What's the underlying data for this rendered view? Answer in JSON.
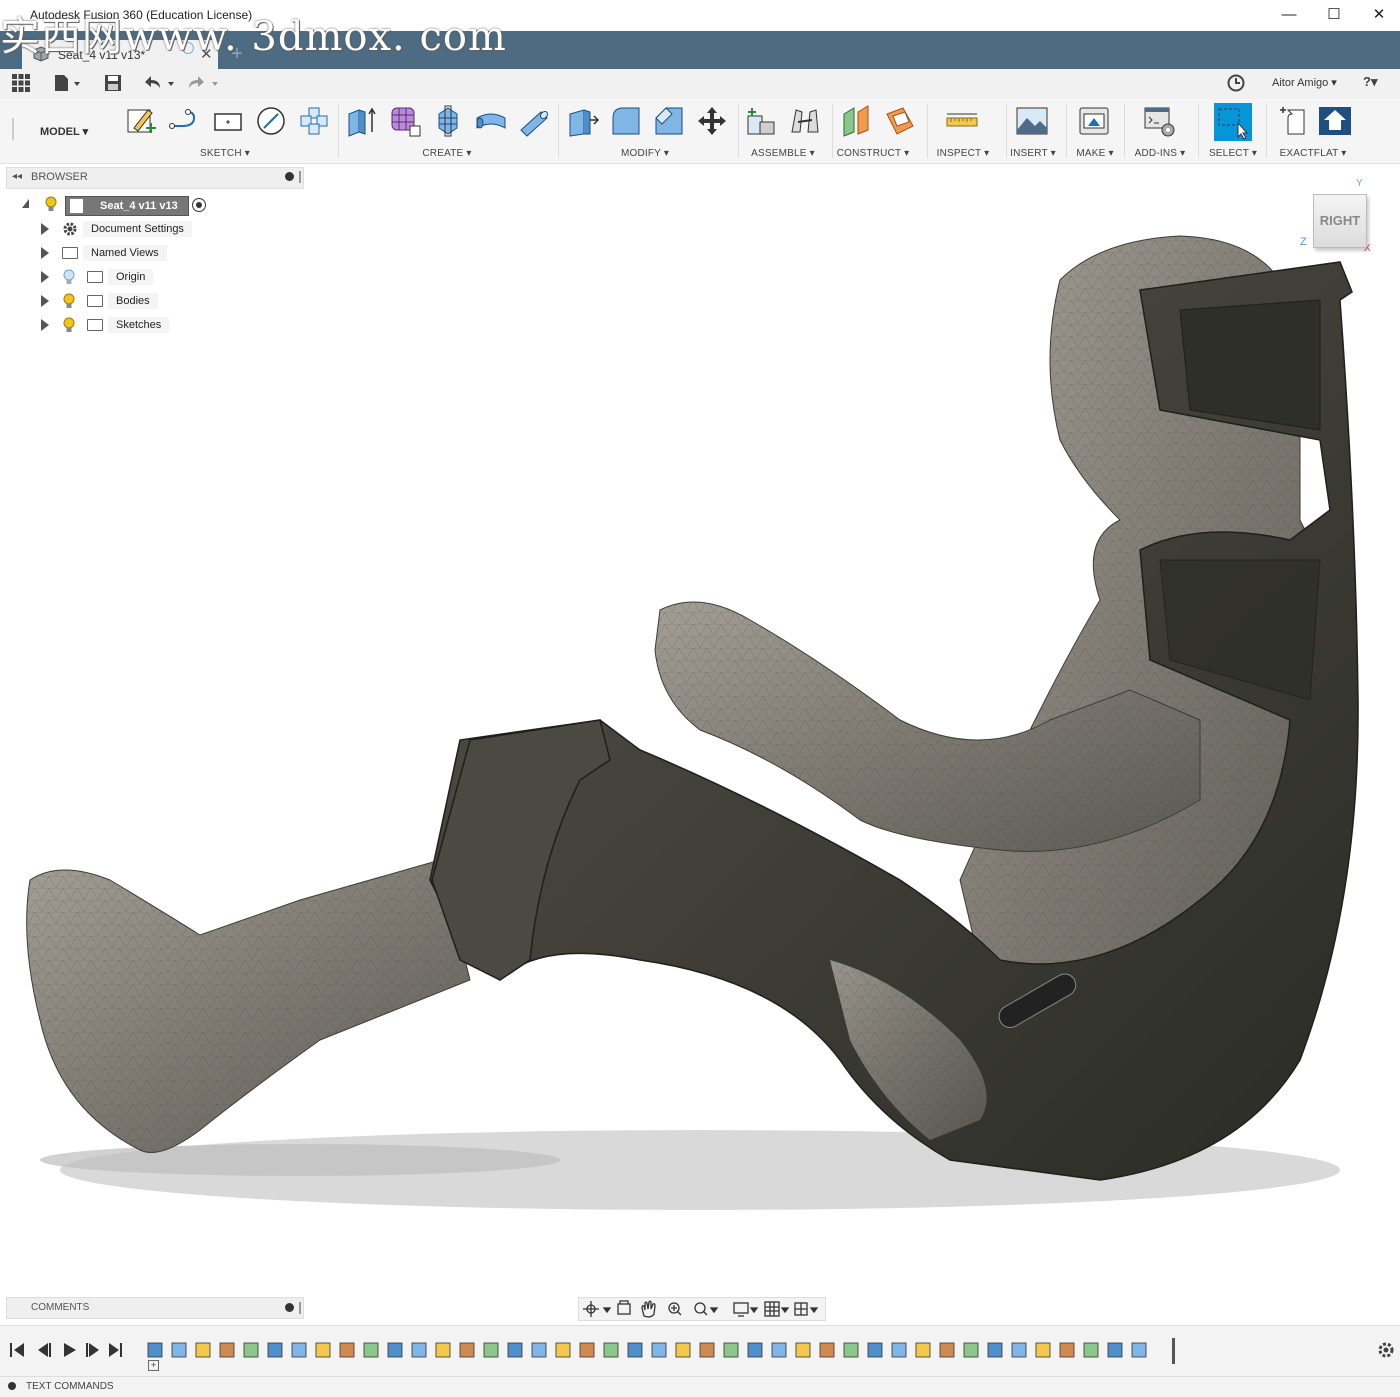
{
  "window": {
    "title": "Autodesk Fusion 360 (Education License)",
    "watermark": "实西网www. 3dmox. com",
    "minimize": "—",
    "maximize": "☐",
    "close": "✕"
  },
  "document_tab": {
    "label": "Seat_4 v11 v13*",
    "close": "✕",
    "new_tab": "+"
  },
  "quick_access": {
    "user": "Aitor Amigo ▾",
    "help": "?▾"
  },
  "workspace": {
    "label": "MODEL ▾"
  },
  "ribbon_groups": [
    {
      "label": "SKETCH ▾"
    },
    {
      "label": "CREATE ▾"
    },
    {
      "label": "MODIFY ▾"
    },
    {
      "label": "ASSEMBLE ▾"
    },
    {
      "label": "CONSTRUCT ▾"
    },
    {
      "label": "INSPECT ▾"
    },
    {
      "label": "INSERT ▾"
    },
    {
      "label": "MAKE ▾"
    },
    {
      "label": "ADD-INS ▾"
    },
    {
      "label": "SELECT ▾"
    },
    {
      "label": "EXACTFLAT ▾"
    }
  ],
  "browser": {
    "title": "BROWSER",
    "root": "Seat_4 v11 v13",
    "items": [
      {
        "label": "Document Settings",
        "icon": "gear-icon"
      },
      {
        "label": "Named Views",
        "icon": "folder-icon"
      },
      {
        "label": "Origin",
        "icon": "folder-icon",
        "bulb": "#9ec8e8"
      },
      {
        "label": "Bodies",
        "icon": "folder-icon",
        "bulb": "#f0c419"
      },
      {
        "label": "Sketches",
        "icon": "folder-icon",
        "bulb": "#f0c419"
      }
    ]
  },
  "viewcube": {
    "face": "RIGHT",
    "axis_y": "Y",
    "axis_z": "Z",
    "axis_x": "X"
  },
  "comments": {
    "title": "COMMENTS"
  },
  "text_commands": {
    "title": "TEXT COMMANDS"
  },
  "colors": {
    "accent_blue": "#0696d7",
    "tabstrip": "#4d6b82",
    "seat_dark": "#3a3a34",
    "body_mesh": "#8a877f"
  }
}
